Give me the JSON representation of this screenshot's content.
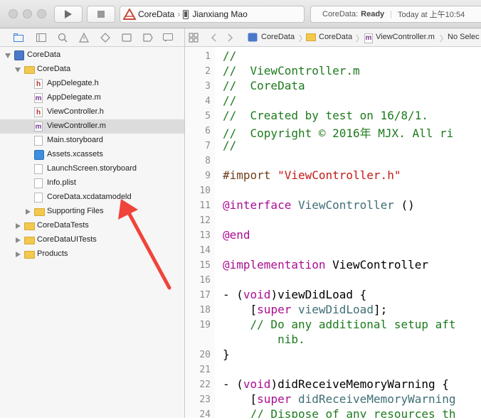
{
  "toolbar": {
    "scheme_project": "CoreData",
    "scheme_device": "Jianxiang Mao",
    "status_project": "CoreData:",
    "status_state": "Ready",
    "status_time": "Today at 上午10:54",
    "icons": [
      "close-light",
      "minimize-light",
      "zoom-light",
      "run-icon",
      "stop-icon",
      "xcode-app-icon",
      "device-icon"
    ]
  },
  "navigator_icons": [
    "folder-icon",
    "source-control-icon",
    "search-icon",
    "warning-icon",
    "test-icon",
    "debug-icon",
    "breakpoint-icon",
    "report-icon"
  ],
  "tree": [
    {
      "label": "CoreData",
      "level": 0,
      "disclosure": "open",
      "icon": "project"
    },
    {
      "label": "CoreData",
      "level": 1,
      "disclosure": "open",
      "icon": "folder"
    },
    {
      "label": "AppDelegate.h",
      "level": 2,
      "disclosure": "none",
      "icon": "h"
    },
    {
      "label": "AppDelegate.m",
      "level": 2,
      "disclosure": "none",
      "icon": "m"
    },
    {
      "label": "ViewController.h",
      "level": 2,
      "disclosure": "none",
      "icon": "h"
    },
    {
      "label": "ViewController.m",
      "level": 2,
      "disclosure": "none",
      "icon": "m",
      "selected": true
    },
    {
      "label": "Main.storyboard",
      "level": 2,
      "disclosure": "none",
      "icon": "plain"
    },
    {
      "label": "Assets.xcassets",
      "level": 2,
      "disclosure": "none",
      "icon": "assets"
    },
    {
      "label": "LaunchScreen.storyboard",
      "level": 2,
      "disclosure": "none",
      "icon": "plain"
    },
    {
      "label": "Info.plist",
      "level": 2,
      "disclosure": "none",
      "icon": "plain"
    },
    {
      "label": "CoreData.xcdatamodeld",
      "level": 2,
      "disclosure": "none",
      "icon": "plain"
    },
    {
      "label": "Supporting Files",
      "level": 2,
      "disclosure": "closed",
      "icon": "folder"
    },
    {
      "label": "CoreDataTests",
      "level": 1,
      "disclosure": "closed",
      "icon": "folder"
    },
    {
      "label": "CoreDataUITests",
      "level": 1,
      "disclosure": "closed",
      "icon": "folder"
    },
    {
      "label": "Products",
      "level": 1,
      "disclosure": "closed",
      "icon": "folder"
    }
  ],
  "jumpbar": {
    "crumbs": [
      "CoreData",
      "CoreData",
      "ViewController.m",
      "No Selec"
    ]
  },
  "editor": {
    "lines": [
      {
        "n": "1",
        "segs": [
          {
            "t": "//",
            "c": "cm"
          }
        ]
      },
      {
        "n": "2",
        "segs": [
          {
            "t": "//  ViewController.m",
            "c": "cm"
          }
        ]
      },
      {
        "n": "3",
        "segs": [
          {
            "t": "//  CoreData",
            "c": "cm"
          }
        ]
      },
      {
        "n": "4",
        "segs": [
          {
            "t": "//",
            "c": "cm"
          }
        ]
      },
      {
        "n": "5",
        "segs": [
          {
            "t": "//  Created by test on 16/8/1.",
            "c": "cm"
          }
        ]
      },
      {
        "n": "6",
        "segs": [
          {
            "t": "//  Copyright © 2016年 MJX. All ri",
            "c": "cm"
          }
        ]
      },
      {
        "n": "7",
        "segs": [
          {
            "t": "//",
            "c": "cm"
          }
        ]
      },
      {
        "n": "8",
        "segs": []
      },
      {
        "n": "9",
        "segs": [
          {
            "t": "#import ",
            "c": "pp"
          },
          {
            "t": "\"ViewController.h\"",
            "c": "str"
          }
        ]
      },
      {
        "n": "10",
        "segs": []
      },
      {
        "n": "11",
        "segs": [
          {
            "t": "@interface",
            "c": "kw"
          },
          {
            "t": " ",
            "c": ""
          },
          {
            "t": "ViewController",
            "c": "cls"
          },
          {
            "t": " ()",
            "c": ""
          }
        ]
      },
      {
        "n": "12",
        "segs": []
      },
      {
        "n": "13",
        "segs": [
          {
            "t": "@end",
            "c": "kw"
          }
        ]
      },
      {
        "n": "14",
        "segs": []
      },
      {
        "n": "15",
        "segs": [
          {
            "t": "@implementation",
            "c": "kw"
          },
          {
            "t": " ViewController",
            "c": ""
          }
        ]
      },
      {
        "n": "16",
        "segs": []
      },
      {
        "n": "17",
        "segs": [
          {
            "t": "- (",
            "c": ""
          },
          {
            "t": "void",
            "c": "kw"
          },
          {
            "t": ")viewDidLoad {",
            "c": ""
          }
        ]
      },
      {
        "n": "18",
        "segs": [
          {
            "t": "    [",
            "c": ""
          },
          {
            "t": "super",
            "c": "kw"
          },
          {
            "t": " ",
            "c": ""
          },
          {
            "t": "viewDidLoad",
            "c": "cls"
          },
          {
            "t": "];",
            "c": ""
          }
        ]
      },
      {
        "n": "19",
        "segs": [
          {
            "t": "    // Do any additional setup aft",
            "c": "cm"
          }
        ]
      },
      {
        "n": "",
        "segs": [
          {
            "t": "        nib.",
            "c": "cm"
          }
        ]
      },
      {
        "n": "20",
        "segs": [
          {
            "t": "}",
            "c": ""
          }
        ]
      },
      {
        "n": "21",
        "segs": []
      },
      {
        "n": "22",
        "segs": [
          {
            "t": "- (",
            "c": ""
          },
          {
            "t": "void",
            "c": "kw"
          },
          {
            "t": ")didReceiveMemoryWarning {",
            "c": ""
          }
        ]
      },
      {
        "n": "23",
        "segs": [
          {
            "t": "    [",
            "c": ""
          },
          {
            "t": "super",
            "c": "kw"
          },
          {
            "t": " ",
            "c": ""
          },
          {
            "t": "didReceiveMemoryWarning",
            "c": "cls"
          }
        ]
      },
      {
        "n": "24",
        "segs": [
          {
            "t": "    // Dispose of any resources th",
            "c": "cm"
          }
        ]
      }
    ]
  },
  "annotation": {
    "color": "#f0443a"
  }
}
